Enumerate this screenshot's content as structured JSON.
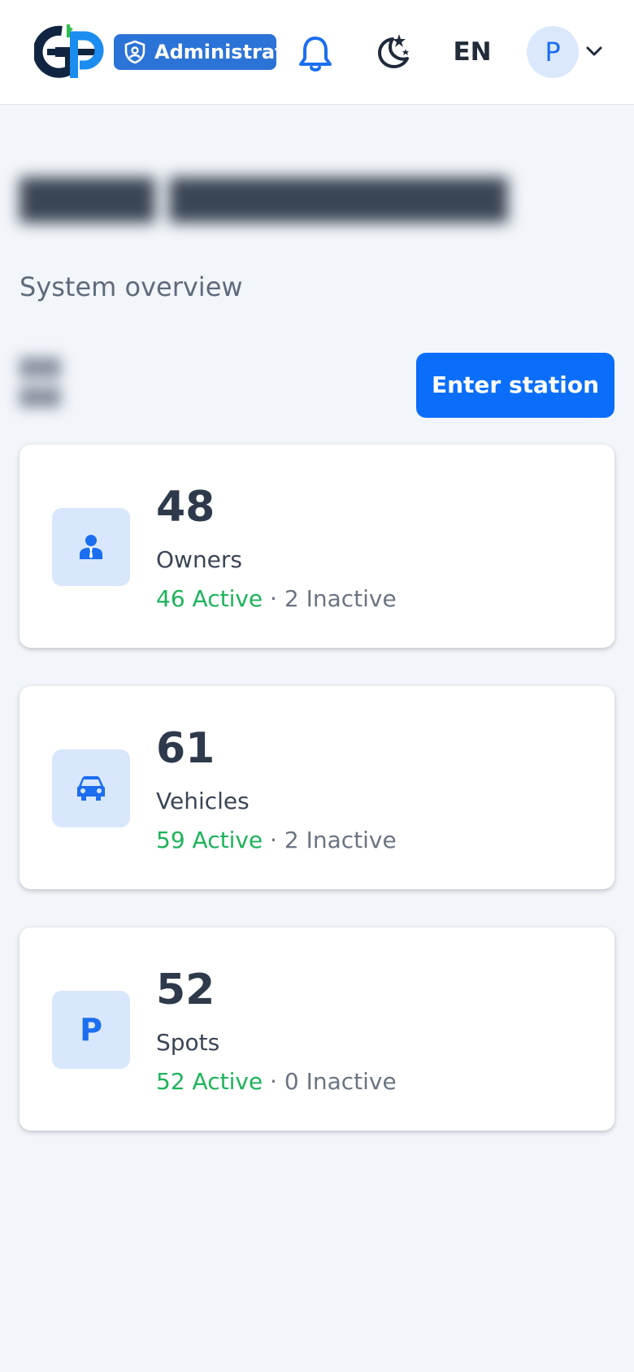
{
  "header": {
    "role_badge": "Administrat",
    "language": "EN",
    "avatar_initial": "P",
    "icons": [
      "logo",
      "shield-icon",
      "bell-icon",
      "moon-icon",
      "chevron-down-icon"
    ]
  },
  "main": {
    "subtitle": "System overview",
    "enter_button_label": "Enter station"
  },
  "cards": [
    {
      "count": "48",
      "label": "Owners",
      "active": "46 Active",
      "separator": "·",
      "inactive": "2 Inactive",
      "icon": "owner-icon"
    },
    {
      "count": "61",
      "label": "Vehicles",
      "active": "59 Active",
      "separator": "·",
      "inactive": "2 Inactive",
      "icon": "car-icon"
    },
    {
      "count": "52",
      "label": "Spots",
      "active": "52 Active",
      "separator": "·",
      "inactive": "0 Inactive",
      "icon": "parking-icon",
      "icon_text": "P"
    }
  ],
  "colors": {
    "accent": "#0b6efb",
    "badge": "#2b73d6",
    "active": "#1db35a",
    "icon_bg": "#d8e7fb",
    "page_bg": "#f2f5f9"
  }
}
